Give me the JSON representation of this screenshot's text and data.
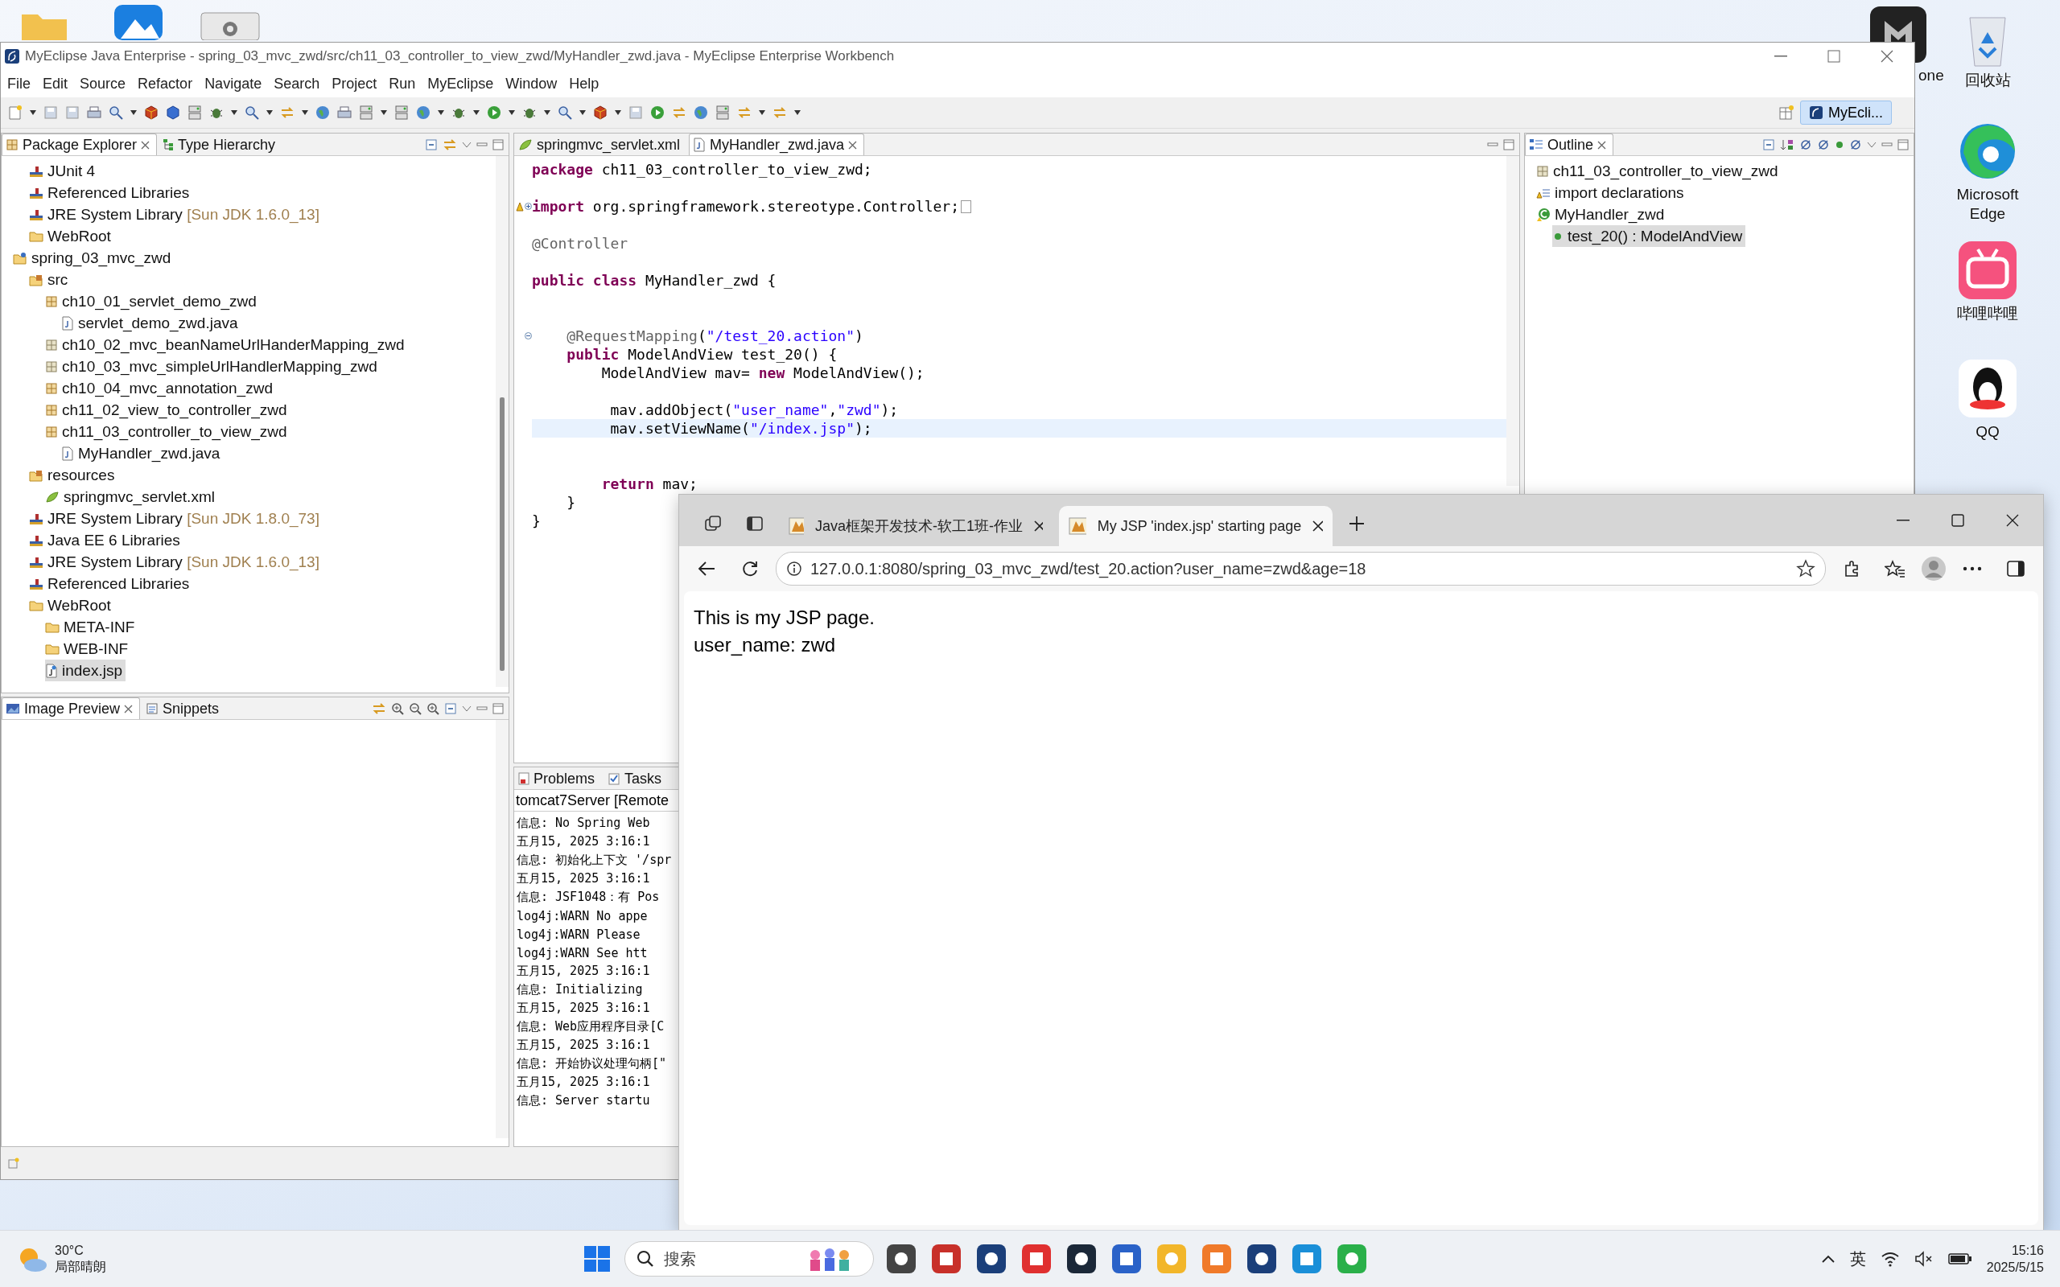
{
  "eclipse": {
    "title": "MyEclipse Java Enterprise - spring_03_mvc_zwd/src/ch11_03_controller_to_view_zwd/MyHandler_zwd.java - MyEclipse Enterprise Workbench",
    "menu": [
      "File",
      "Edit",
      "Source",
      "Refactor",
      "Navigate",
      "Search",
      "Project",
      "Run",
      "MyEclipse",
      "Window",
      "Help"
    ],
    "perspectives": [
      {
        "label": "MyEcli...",
        "selected": true
      }
    ],
    "package_explorer": {
      "tabs": [
        {
          "label": "Package Explorer",
          "kind": "package",
          "selected": true
        },
        {
          "label": "Type Hierarchy",
          "kind": "hierarchy",
          "selected": false
        }
      ],
      "tree": [
        {
          "children": [
            {
              "label": "JUnit 4",
              "kind": "library",
              "selected": false
            },
            {
              "label": "Referenced Libraries",
              "kind": "library",
              "selected": false
            },
            {
              "label": "JRE System Library",
              "detail": "[Sun JDK 1.6.0_13]",
              "kind": "library",
              "selected": false
            },
            {
              "label": "WebRoot",
              "kind": "folder",
              "selected": false
            }
          ]
        },
        {
          "label": "spring_03_mvc_zwd",
          "kind": "project",
          "selected": false,
          "children": [
            {
              "label": "src",
              "kind": "source",
              "selected": false,
              "children": [
                {
                  "label": "ch10_01_servlet_demo_zwd",
                  "kind": "package",
                  "selected": false,
                  "children": [
                    {
                      "label": "servlet_demo_zwd.java",
                      "kind": "java",
                      "selected": false
                    }
                  ]
                },
                {
                  "label": "ch10_02_mvc_beanNameUrlHanderMapping_zwd",
                  "kind": "empty-package",
                  "selected": false
                },
                {
                  "label": "ch10_03_mvc_simpleUrlHandlerMapping_zwd",
                  "kind": "empty-package",
                  "selected": false
                },
                {
                  "label": "ch10_04_mvc_annotation_zwd",
                  "kind": "package",
                  "selected": false
                },
                {
                  "label": "ch11_02_view_to_controller_zwd",
                  "kind": "package",
                  "selected": false
                },
                {
                  "label": "ch11_03_controller_to_view_zwd",
                  "kind": "package",
                  "selected": false,
                  "children": [
                    {
                      "label": "MyHandler_zwd.java",
                      "kind": "java",
                      "selected": false
                    }
                  ]
                }
              ]
            },
            {
              "label": "resources",
              "kind": "source",
              "selected": false,
              "children": [
                {
                  "label": "springmvc_servlet.xml",
                  "kind": "xml",
                  "selected": false
                }
              ]
            },
            {
              "label": "JRE System Library",
              "detail": "[Sun JDK 1.8.0_73]",
              "kind": "library",
              "selected": false
            },
            {
              "label": "Java EE 6 Libraries",
              "kind": "library",
              "selected": false
            },
            {
              "label": "JRE System Library",
              "detail": "[Sun JDK 1.6.0_13]",
              "kind": "library",
              "selected": false
            },
            {
              "label": "Referenced Libraries",
              "kind": "library",
              "selected": false
            },
            {
              "label": "WebRoot",
              "kind": "folder",
              "selected": false,
              "children": [
                {
                  "label": "META-INF",
                  "kind": "folder",
                  "selected": false
                },
                {
                  "label": "WEB-INF",
                  "kind": "folder",
                  "selected": false
                },
                {
                  "label": "index.jsp",
                  "kind": "jsp",
                  "selected": true
                }
              ]
            }
          ]
        }
      ]
    },
    "image_preview": {
      "tabs": [
        {
          "label": "Image Preview",
          "kind": "image",
          "selected": true
        },
        {
          "label": "Snippets",
          "kind": "snippets",
          "selected": false
        }
      ]
    },
    "editor": {
      "tabs": [
        {
          "label": "springmvc_servlet.xml",
          "kind": "xml",
          "selected": false
        },
        {
          "label": "MyHandler_zwd.java",
          "kind": "java",
          "selected": true
        }
      ],
      "lines": [
        {
          "kind": "code",
          "current": false,
          "tokens": [
            {
              "kind": "keyword",
              "text": "package"
            },
            {
              "kind": "plain",
              "text": " ch11_03_controller_to_view_zwd;"
            }
          ]
        },
        {
          "kind": "blank",
          "current": false
        },
        {
          "kind": "folded",
          "current": false,
          "tokens": [
            {
              "kind": "keyword",
              "text": "import"
            },
            {
              "kind": "plain",
              "text": " org.springframework.stereotype.Controller;"
            }
          ]
        },
        {
          "kind": "blank",
          "current": false
        },
        {
          "kind": "code",
          "current": false,
          "tokens": [
            {
              "kind": "annotation",
              "text": "@Controller"
            }
          ]
        },
        {
          "kind": "blank",
          "current": false
        },
        {
          "kind": "code",
          "current": false,
          "tokens": [
            {
              "kind": "keyword",
              "text": "public"
            },
            {
              "kind": "keyword",
              "text": " class"
            },
            {
              "kind": "plain",
              "text": " MyHandler_zwd {"
            }
          ]
        },
        {
          "kind": "blank",
          "current": false
        },
        {
          "kind": "blank",
          "current": false
        },
        {
          "kind": "fold-start",
          "current": false,
          "tokens": [
            {
              "kind": "annotation",
              "text": "    @RequestMapping"
            },
            {
              "kind": "plain",
              "text": "("
            },
            {
              "kind": "string",
              "text": "\"/test_20.action\""
            },
            {
              "kind": "plain",
              "text": ")"
            }
          ]
        },
        {
          "kind": "code",
          "current": false,
          "tokens": [
            {
              "kind": "keyword",
              "text": "    public"
            },
            {
              "kind": "plain",
              "text": " ModelAndView test_20() {"
            }
          ]
        },
        {
          "kind": "code",
          "current": false,
          "tokens": [
            {
              "kind": "plain",
              "text": "        ModelAndView mav= "
            },
            {
              "kind": "keyword",
              "text": "new"
            },
            {
              "kind": "plain",
              "text": " ModelAndView();"
            }
          ]
        },
        {
          "kind": "blank",
          "current": false
        },
        {
          "kind": "code",
          "current": false,
          "tokens": [
            {
              "kind": "plain",
              "text": "         mav.addObject("
            },
            {
              "kind": "string",
              "text": "\"user_name\""
            },
            {
              "kind": "plain",
              "text": ","
            },
            {
              "kind": "string",
              "text": "\"zwd\""
            },
            {
              "kind": "plain",
              "text": ");"
            }
          ]
        },
        {
          "kind": "code",
          "current": true,
          "tokens": [
            {
              "kind": "plain",
              "text": "         mav.setViewName("
            },
            {
              "kind": "string",
              "text": "\"/index.jsp\""
            },
            {
              "kind": "plain",
              "text": ");"
            }
          ]
        },
        {
          "kind": "blank",
          "current": false
        },
        {
          "kind": "blank",
          "current": false
        },
        {
          "kind": "code",
          "current": false,
          "tokens": [
            {
              "kind": "keyword",
              "text": "        return"
            },
            {
              "kind": "plain",
              "text": " mav;"
            }
          ]
        },
        {
          "kind": "code",
          "current": false,
          "tokens": [
            {
              "kind": "plain",
              "text": "    }"
            }
          ]
        },
        {
          "kind": "code",
          "current": false,
          "tokens": [
            {
              "kind": "plain",
              "text": "}"
            }
          ]
        }
      ]
    },
    "outline": {
      "tabs": [
        {
          "label": "Outline",
          "kind": "outline",
          "selected": true
        }
      ],
      "tree": [
        {
          "label": "ch11_03_controller_to_view_zwd",
          "kind": "empty-package",
          "selected": false
        },
        {
          "label": "import declarations",
          "kind": "imports",
          "selected": false
        },
        {
          "label": "MyHandler_zwd",
          "kind": "class",
          "selected": false,
          "children": [
            {
              "label": "test_20() : ModelAndView",
              "kind": "method",
              "selected": true
            }
          ]
        }
      ]
    },
    "console": {
      "tabs": [
        {
          "label": "Problems",
          "kind": "problems",
          "selected": false
        },
        {
          "label": "Tasks",
          "kind": "tasks",
          "selected": false
        }
      ],
      "title": "tomcat7Server [Remote",
      "lines": [
        "信息: No Spring Web",
        "五月15, 2025 3:16:1",
        "信息: 初始化上下文 '/spr",
        "五月15, 2025 3:16:1",
        "信息: JSF1048：有 Pos",
        "log4j:WARN No appe",
        "log4j:WARN Please",
        "log4j:WARN See htt",
        "五月15, 2025 3:16:1",
        "信息: Initializing",
        "五月15, 2025 3:16:1",
        "信息: Web应用程序目录[C",
        "五月15, 2025 3:16:1",
        "信息: 开始协议处理句柄[\"",
        "五月15, 2025 3:16:1",
        "信息: Server startu"
      ]
    }
  },
  "browser": {
    "tabs": [
      {
        "title": "Java框架开发技术-软工1班-作业",
        "selected": false
      },
      {
        "title": "My JSP 'index.jsp' starting page",
        "selected": true
      }
    ],
    "url": "127.0.0.1:8080/spring_03_mvc_zwd/test_20.action?user_name=zwd&age=18",
    "content": [
      "This is my JSP page.",
      "user_name: zwd"
    ]
  },
  "desktop_icons": [
    {
      "label": "回收站",
      "kind": "bin"
    },
    {
      "label": "Microsoft Edge",
      "kind": "edge"
    },
    {
      "label": "哔哩哔哩",
      "kind": "bili"
    },
    {
      "label": "QQ",
      "kind": "qq"
    }
  ],
  "desktop_partial_label": "one",
  "taskbar": {
    "temperature": "30°C",
    "weather": "局部晴朗",
    "search_placeholder": "搜索",
    "ime": "英",
    "time": "15:16",
    "date": "2025/5/15"
  }
}
